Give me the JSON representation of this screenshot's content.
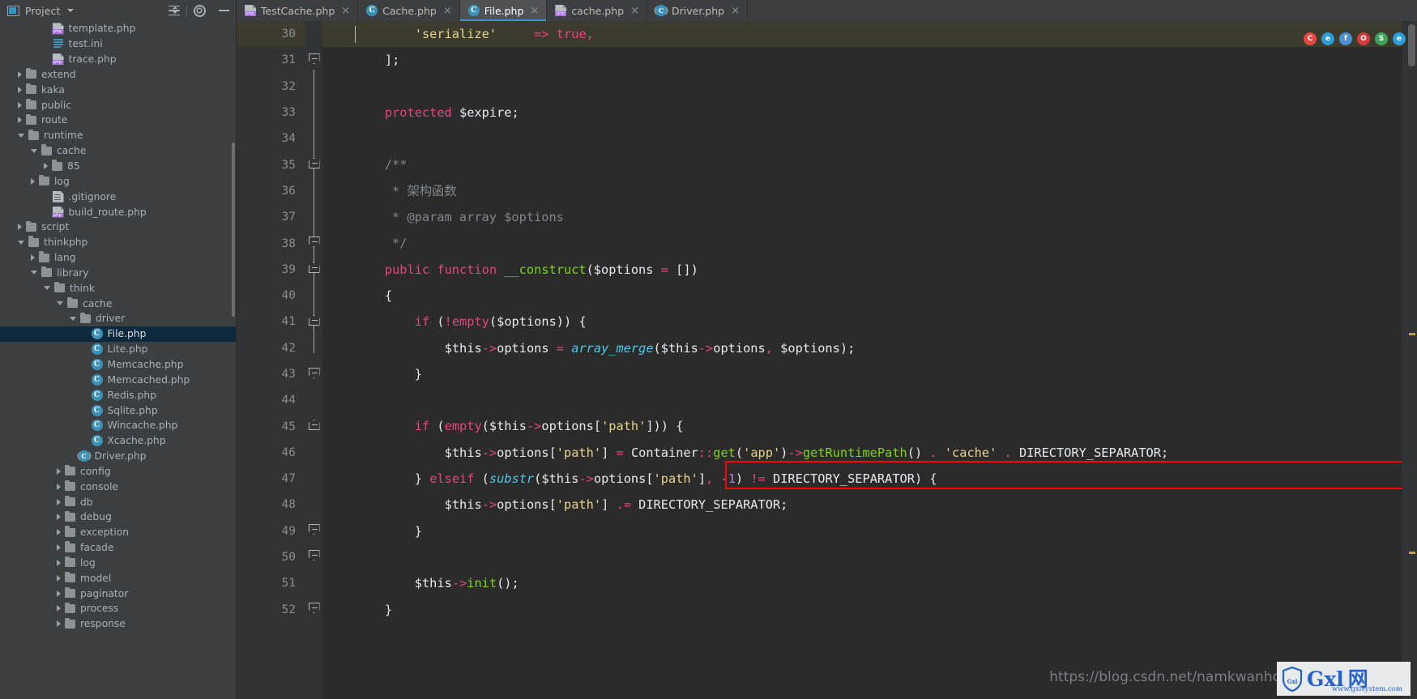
{
  "project_panel": {
    "title": "Project",
    "icons": [
      "project-icon",
      "chevron-down-icon",
      "collapse-all-icon",
      "gear-icon"
    ]
  },
  "window": {
    "minimize_label": "—"
  },
  "tabs": [
    {
      "label": "TestCache.php",
      "icon": "php-file-icon",
      "active": false,
      "close": "×"
    },
    {
      "label": "Cache.php",
      "icon": "php-class-icon",
      "active": false,
      "close": "×"
    },
    {
      "label": "File.php",
      "icon": "php-class-icon",
      "active": true,
      "close": "×"
    },
    {
      "label": "cache.php",
      "icon": "php-file-icon",
      "active": false,
      "close": "×"
    },
    {
      "label": "Driver.php",
      "icon": "php-abstract-class-icon",
      "active": false,
      "close": "×"
    }
  ],
  "tree": [
    {
      "label": "template.php",
      "depth": 3,
      "arrow": "none",
      "icon": "php-file-icon"
    },
    {
      "label": "test.ini",
      "depth": 3,
      "arrow": "none",
      "icon": "ini-file-icon"
    },
    {
      "label": "trace.php",
      "depth": 3,
      "arrow": "none",
      "icon": "php-file-icon"
    },
    {
      "label": "extend",
      "depth": 1,
      "arrow": "right",
      "icon": "folder-icon"
    },
    {
      "label": "kaka",
      "depth": 1,
      "arrow": "right",
      "icon": "folder-icon"
    },
    {
      "label": "public",
      "depth": 1,
      "arrow": "right",
      "icon": "folder-icon"
    },
    {
      "label": "route",
      "depth": 1,
      "arrow": "right",
      "icon": "folder-icon"
    },
    {
      "label": "runtime",
      "depth": 1,
      "arrow": "down",
      "icon": "folder-icon"
    },
    {
      "label": "cache",
      "depth": 2,
      "arrow": "down",
      "icon": "folder-icon"
    },
    {
      "label": "85",
      "depth": 3,
      "arrow": "right",
      "icon": "folder-icon"
    },
    {
      "label": "log",
      "depth": 2,
      "arrow": "right",
      "icon": "folder-icon"
    },
    {
      "label": ".gitignore",
      "depth": 3,
      "arrow": "none",
      "icon": "text-file-icon"
    },
    {
      "label": "build_route.php",
      "depth": 3,
      "arrow": "none",
      "icon": "php-file-icon"
    },
    {
      "label": "script",
      "depth": 1,
      "arrow": "right",
      "icon": "folder-icon"
    },
    {
      "label": "thinkphp",
      "depth": 1,
      "arrow": "down",
      "icon": "folder-icon"
    },
    {
      "label": "lang",
      "depth": 2,
      "arrow": "right",
      "icon": "folder-icon"
    },
    {
      "label": "library",
      "depth": 2,
      "arrow": "down",
      "icon": "folder-icon"
    },
    {
      "label": "think",
      "depth": 3,
      "arrow": "down",
      "icon": "folder-icon"
    },
    {
      "label": "cache",
      "depth": 4,
      "arrow": "down",
      "icon": "folder-icon"
    },
    {
      "label": "driver",
      "depth": 5,
      "arrow": "down",
      "icon": "folder-icon"
    },
    {
      "label": "File.php",
      "depth": 6,
      "arrow": "none",
      "icon": "php-class-icon",
      "selected": true
    },
    {
      "label": "Lite.php",
      "depth": 6,
      "arrow": "none",
      "icon": "php-class-icon"
    },
    {
      "label": "Memcache.php",
      "depth": 6,
      "arrow": "none",
      "icon": "php-class-icon"
    },
    {
      "label": "Memcached.php",
      "depth": 6,
      "arrow": "none",
      "icon": "php-class-icon"
    },
    {
      "label": "Redis.php",
      "depth": 6,
      "arrow": "none",
      "icon": "php-class-icon"
    },
    {
      "label": "Sqlite.php",
      "depth": 6,
      "arrow": "none",
      "icon": "php-class-icon"
    },
    {
      "label": "Wincache.php",
      "depth": 6,
      "arrow": "none",
      "icon": "php-class-icon"
    },
    {
      "label": "Xcache.php",
      "depth": 6,
      "arrow": "none",
      "icon": "php-class-icon"
    },
    {
      "label": "Driver.php",
      "depth": 5,
      "arrow": "none",
      "icon": "php-abstract-class-icon"
    },
    {
      "label": "config",
      "depth": 4,
      "arrow": "right",
      "icon": "folder-icon"
    },
    {
      "label": "console",
      "depth": 4,
      "arrow": "right",
      "icon": "folder-icon"
    },
    {
      "label": "db",
      "depth": 4,
      "arrow": "right",
      "icon": "folder-icon"
    },
    {
      "label": "debug",
      "depth": 4,
      "arrow": "right",
      "icon": "folder-icon"
    },
    {
      "label": "exception",
      "depth": 4,
      "arrow": "right",
      "icon": "folder-icon"
    },
    {
      "label": "facade",
      "depth": 4,
      "arrow": "right",
      "icon": "folder-icon"
    },
    {
      "label": "log",
      "depth": 4,
      "arrow": "right",
      "icon": "folder-icon"
    },
    {
      "label": "model",
      "depth": 4,
      "arrow": "right",
      "icon": "folder-icon"
    },
    {
      "label": "paginator",
      "depth": 4,
      "arrow": "right",
      "icon": "folder-icon"
    },
    {
      "label": "process",
      "depth": 4,
      "arrow": "right",
      "icon": "folder-icon"
    },
    {
      "label": "response",
      "depth": 4,
      "arrow": "right",
      "icon": "folder-icon"
    }
  ],
  "editor": {
    "first_line_number": 30,
    "last_line_number": 52,
    "highlighted_line": 46,
    "current_line": 30,
    "lines": [
      {
        "n": 30,
        "text": "        'serialize'     => true,"
      },
      {
        "n": 31,
        "text": "    ];"
      },
      {
        "n": 32,
        "text": ""
      },
      {
        "n": 33,
        "text": "    protected $expire;"
      },
      {
        "n": 34,
        "text": ""
      },
      {
        "n": 35,
        "text": "    /**"
      },
      {
        "n": 36,
        "text": "     * 架构函数"
      },
      {
        "n": 37,
        "text": "     * @param array $options"
      },
      {
        "n": 38,
        "text": "     */"
      },
      {
        "n": 39,
        "text": "    public function __construct($options = [])"
      },
      {
        "n": 40,
        "text": "    {"
      },
      {
        "n": 41,
        "text": "        if (!empty($options)) {"
      },
      {
        "n": 42,
        "text": "            $this->options = array_merge($this->options, $options);"
      },
      {
        "n": 43,
        "text": "        }"
      },
      {
        "n": 44,
        "text": ""
      },
      {
        "n": 45,
        "text": "        if (empty($this->options['path'])) {"
      },
      {
        "n": 46,
        "text": "            $this->options['path'] = Container::get('app')->getRuntimePath() . 'cache' . DIRECTORY_SEPARATOR;"
      },
      {
        "n": 47,
        "text": "        } elseif (substr($this->options['path'], -1) != DIRECTORY_SEPARATOR) {"
      },
      {
        "n": 48,
        "text": "            $this->options['path'] .= DIRECTORY_SEPARATOR;"
      },
      {
        "n": 49,
        "text": "        }"
      },
      {
        "n": 50,
        "text": ""
      },
      {
        "n": 51,
        "text": "        $this->init();"
      },
      {
        "n": 52,
        "text": "    }"
      }
    ]
  },
  "browser_icons": [
    "chrome-icon",
    "ie-icon",
    "firefox-icon",
    "opera-icon",
    "safari-icon",
    "edge-icon"
  ],
  "watermark": {
    "url": "https://blog.csdn.net/namkwanho",
    "logo_text": "Gxl",
    "logo_cn": "网",
    "logo_shield": "Gxl",
    "logo_sub": "www.gxlsystem.com"
  },
  "colors": {
    "accent": "#4a88c7",
    "selection": "#0d293e",
    "highlight_box": "#ff0000",
    "editor_bg": "#2b2b2b",
    "gutter_bg": "#313335",
    "panel_bg": "#3c3f41",
    "current_line": "#3c3b2e"
  }
}
